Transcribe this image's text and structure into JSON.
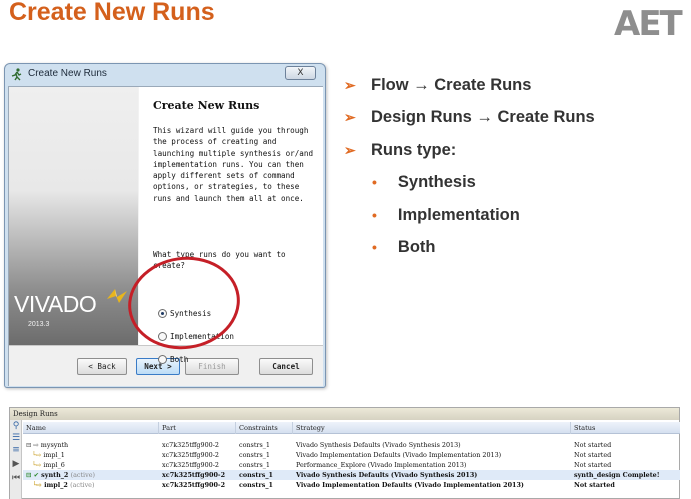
{
  "slide": {
    "title": "Create New Runs",
    "logo": "AET"
  },
  "dialog": {
    "title": "Create New Runs",
    "close_label": "X",
    "brand_word": "VIVADO",
    "brand_version": "2013.3",
    "heading": "Create New Runs",
    "description": "This wizard will guide you through the process of creating and launching multiple synthesis or/and implementation runs. You can then apply different sets of command options, or strategies, to these runs and launch them all at once.",
    "question": "What type runs do you want to create?",
    "options": [
      {
        "label": "Synthesis",
        "selected": true
      },
      {
        "label": "Implementation",
        "selected": false
      },
      {
        "label": "Both",
        "selected": false
      }
    ],
    "buttons": {
      "back": "< Back",
      "next": "Next >",
      "finish": "Finish",
      "cancel": "Cancel"
    }
  },
  "bullets": {
    "items": [
      "Flow → Create Runs",
      "Design Runs → Create Runs",
      "Runs type:"
    ],
    "sub_items": [
      "Synthesis",
      "Implementation",
      "Both"
    ]
  },
  "design_runs": {
    "title": "Design Runs",
    "columns": [
      "Name",
      "Part",
      "Constraints",
      "Strategy",
      "Status"
    ],
    "rows": [
      {
        "name": "mysynth",
        "name_note": "",
        "part": "xc7k325tffg900-2",
        "constraints": "constrs_1",
        "strategy": "Vivado Synthesis Defaults (Vivado Synthesis 2013)",
        "status": "Not started"
      },
      {
        "name": "impl_1",
        "name_note": "",
        "part": "xc7k325tffg900-2",
        "constraints": "constrs_1",
        "strategy": "Vivado Implementation Defaults (Vivado Implementation 2013)",
        "status": "Not started"
      },
      {
        "name": "impl_6",
        "name_note": "",
        "part": "xc7k325tffg900-2",
        "constraints": "constrs_1",
        "strategy": "Performance_Explore (Vivado Implementation 2013)",
        "status": "Not started"
      },
      {
        "name": "synth_2",
        "name_note": "(active)",
        "part": "xc7k325tffg900-2",
        "constraints": "constrs_1",
        "strategy": "Vivado Synthesis Defaults (Vivado Synthesis 2013)",
        "status": "synth_design Complete!"
      },
      {
        "name": "impl_2",
        "name_note": "(active)",
        "part": "xc7k325tffg900-2",
        "constraints": "constrs_1",
        "strategy": "Vivado Implementation Defaults (Vivado Implementation 2013)",
        "status": "Not started"
      }
    ]
  },
  "colors": {
    "title": "#d4601c",
    "bullet_marker": "#e06a22",
    "annotation_circle": "#c51f27"
  }
}
